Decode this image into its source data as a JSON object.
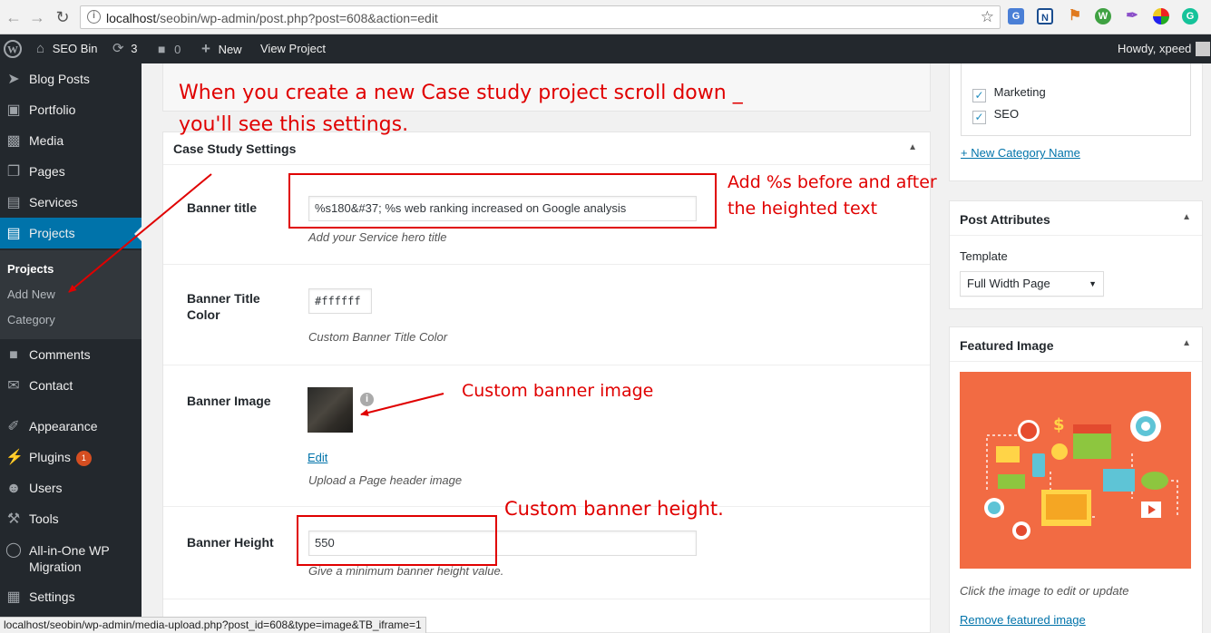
{
  "browser": {
    "url_host": "localhost",
    "url_path": "/seobin/wp-admin/post.php?post=608&action=edit"
  },
  "admin_bar": {
    "site_name": "SEO Bin",
    "updates_count": "3",
    "comments_count": "0",
    "new_label": "New",
    "view_label": "View Project",
    "howdy": "Howdy, xpeed"
  },
  "sidebar": {
    "items": [
      {
        "label": "Blog Posts",
        "icon": "pushpin-icon"
      },
      {
        "label": "Portfolio",
        "icon": "portfolio-icon"
      },
      {
        "label": "Media",
        "icon": "media-icon"
      },
      {
        "label": "Pages",
        "icon": "pages-icon"
      },
      {
        "label": "Services",
        "icon": "services-icon"
      },
      {
        "label": "Projects",
        "icon": "projects-icon"
      },
      {
        "label": "Comments",
        "icon": "comments-icon"
      },
      {
        "label": "Contact",
        "icon": "mail-icon"
      },
      {
        "label": "Appearance",
        "icon": "brush-icon"
      },
      {
        "label": "Plugins",
        "icon": "plugin-icon",
        "badge": "1"
      },
      {
        "label": "Users",
        "icon": "users-icon"
      },
      {
        "label": "Tools",
        "icon": "wrench-icon"
      },
      {
        "label": "All-in-One WP Migration",
        "icon": "migration-icon"
      },
      {
        "label": "Settings",
        "icon": "settings-icon"
      }
    ],
    "submenu": [
      "Projects",
      "Add New",
      "Category"
    ]
  },
  "settings": {
    "title": "Case Study Settings",
    "banner_title_label": "Banner title",
    "banner_title_value": "%s180&#37; %s web ranking increased  on Google analysis",
    "banner_title_desc": "Add your Service hero title",
    "banner_color_label": "Banner Title Color",
    "banner_color_value": "#ffffff",
    "banner_color_desc": "Custom Banner Title Color",
    "banner_image_label": "Banner Image",
    "banner_image_edit": "Edit",
    "banner_image_desc": "Upload a Page header image",
    "banner_height_label": "Banner Height",
    "banner_height_value": "550",
    "banner_height_desc": "Give a minimum banner height value."
  },
  "categories": {
    "items": [
      "Marketing",
      "SEO"
    ],
    "add_link": "+ New Category Name"
  },
  "post_attributes": {
    "title": "Post Attributes",
    "template_label": "Template",
    "template_value": "Full Width Page"
  },
  "featured_image": {
    "title": "Featured Image",
    "hint": "Click the image to edit or update",
    "remove_link": "Remove featured image"
  },
  "annotations": {
    "intro_line1": "When you create a new Case study project scroll down _",
    "intro_line2": "you'll see this settings.",
    "title_note_line1": "Add %s before and after",
    "title_note_line2": "the heighted text",
    "image_note": "Custom banner image",
    "height_note": "Custom banner height."
  },
  "status_bar": "localhost/seobin/wp-admin/media-upload.php?post_id=608&type=image&TB_iframe=1",
  "colors": {
    "admin_dark": "#23282d",
    "accent_blue": "#0073aa",
    "annotation_red": "#e00000",
    "featured_bg": "#f26b43"
  }
}
